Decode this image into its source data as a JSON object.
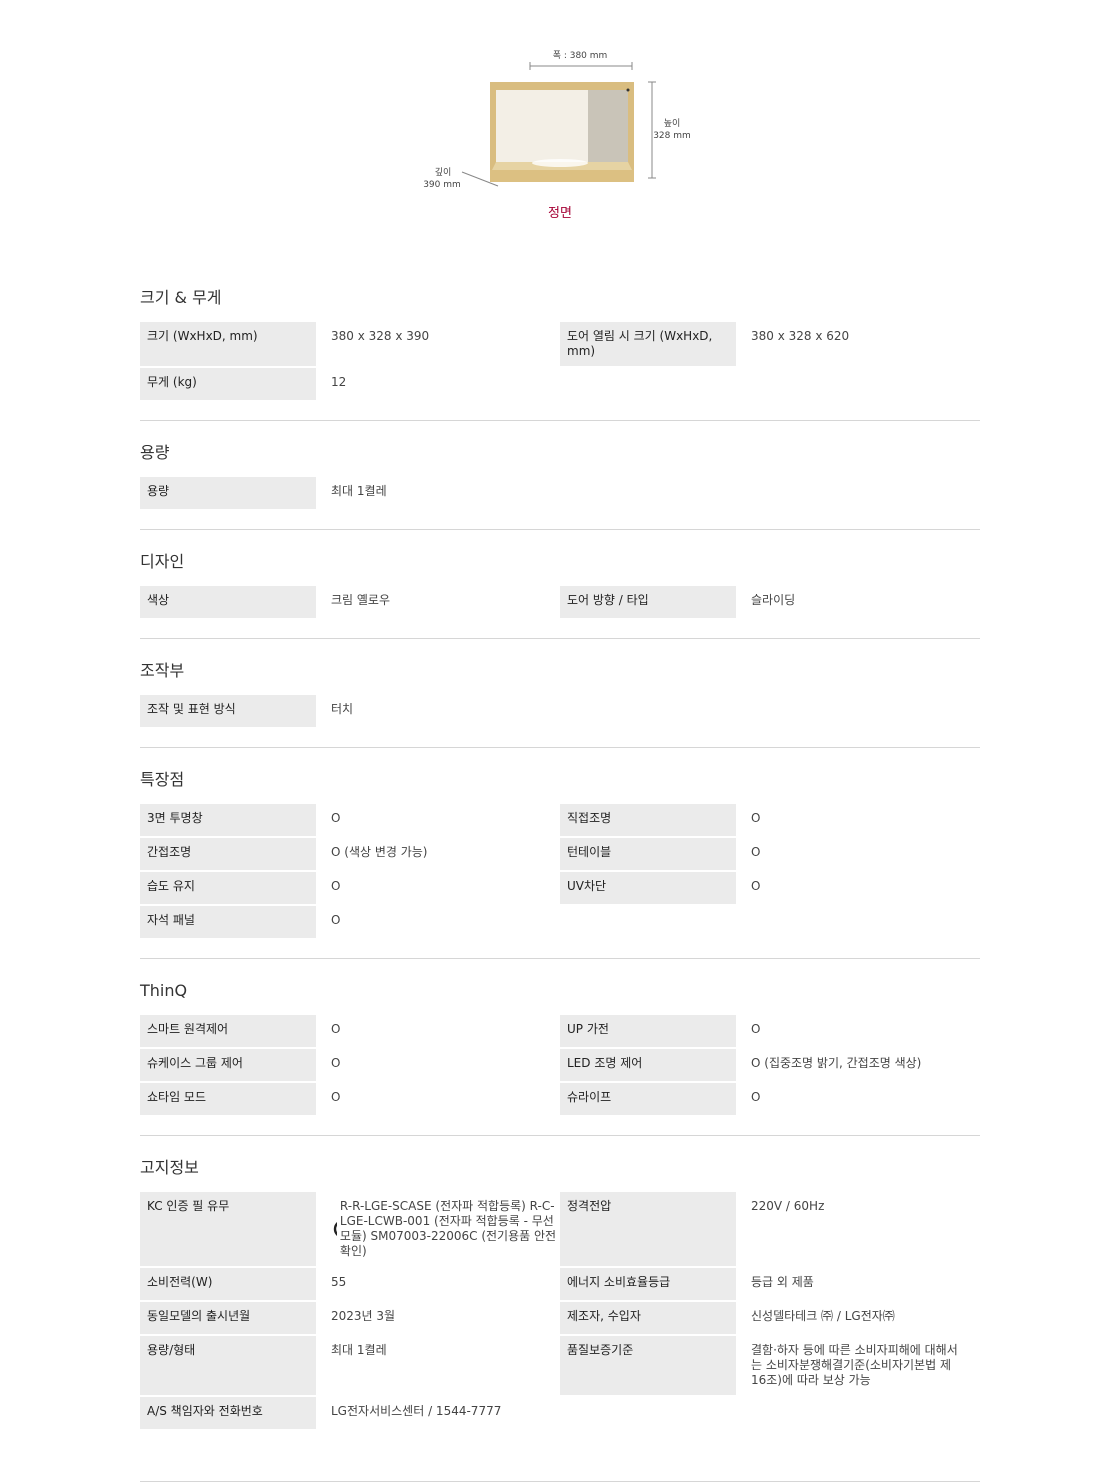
{
  "figure": {
    "width_label": "폭 : 380 mm",
    "height_label_1": "높이",
    "height_label_2": "328 mm",
    "depth_label_1": "깊이",
    "depth_label_2": "390 mm",
    "view_label": "정면"
  },
  "sections": [
    {
      "title": "크기 & 무게",
      "rows": [
        [
          {
            "label": "크기 (WxHxD, mm)",
            "value": "380 x 328 x 390"
          },
          {
            "label": "도어 열림 시 크기 (WxHxD, mm)",
            "value": "380 x 328 x 620"
          }
        ],
        [
          {
            "label": "무게 (kg)",
            "value": "12"
          }
        ]
      ]
    },
    {
      "title": "용량",
      "rows": [
        [
          {
            "label": "용량",
            "value": "최대 1켤레"
          }
        ]
      ]
    },
    {
      "title": "디자인",
      "rows": [
        [
          {
            "label": "색상",
            "value": "크림 옐로우"
          },
          {
            "label": "도어 방향 / 타입",
            "value": "슬라이딩"
          }
        ]
      ]
    },
    {
      "title": "조작부",
      "rows": [
        [
          {
            "label": "조작 및 표현 방식",
            "value": "터치"
          }
        ]
      ]
    },
    {
      "title": "특장점",
      "rows": [
        [
          {
            "label": "3면 투명창",
            "value": "O"
          },
          {
            "label": "직접조명",
            "value": "O"
          }
        ],
        [
          {
            "label": "간접조명",
            "value": "O (색상 변경 가능)"
          },
          {
            "label": "턴테이블",
            "value": "O"
          }
        ],
        [
          {
            "label": "습도 유지",
            "value": "O"
          },
          {
            "label": "UV차단",
            "value": "O"
          }
        ],
        [
          {
            "label": "자석 패널",
            "value": "O"
          }
        ]
      ]
    },
    {
      "title": "ThinQ",
      "rows": [
        [
          {
            "label": "스마트 원격제어",
            "value": "O"
          },
          {
            "label": "UP 가전",
            "value": "O"
          }
        ],
        [
          {
            "label": "슈케이스 그룹 제어",
            "value": "O"
          },
          {
            "label": "LED 조명 제어",
            "value": "O (집중조명 밝기, 간접조명 색상)"
          }
        ],
        [
          {
            "label": "쇼타임 모드",
            "value": "O"
          },
          {
            "label": "슈라이프",
            "value": "O"
          }
        ]
      ]
    },
    {
      "title": "고지정보",
      "rows": [
        [
          {
            "label": "KC 인증 필 유무",
            "value": "R-R-LGE-SCASE (전자파 적합등록) R-C-LGE-LCWB-001 (전자파 적합등록 - 무선모듈) SM07003-22006C (전기용품 안전확인)",
            "kc": true
          },
          {
            "label": "정격전압",
            "value": "220V / 60Hz"
          }
        ],
        [
          {
            "label": "소비전력(W)",
            "value": "55"
          },
          {
            "label": "에너지 소비효율등급",
            "value": "등급 외 제품"
          }
        ],
        [
          {
            "label": "동일모델의 출시년월",
            "value": "2023년 3월"
          },
          {
            "label": "제조자, 수입자",
            "value": "신성델타테크 ㈜ / LG전자㈜"
          }
        ],
        [
          {
            "label": "용량/형태",
            "value": "최대 1켤레"
          },
          {
            "label": "품질보증기준",
            "value": "결함·하자 등에 따른 소비자피해에 대해서는 소비자분쟁해결기준(소비자기본법 제16조)에 따라 보상 가능"
          }
        ],
        [
          {
            "label": "A/S 책임자와 전화번호",
            "value": "LG전자서비스센터 / 1544-7777"
          }
        ]
      ]
    }
  ]
}
